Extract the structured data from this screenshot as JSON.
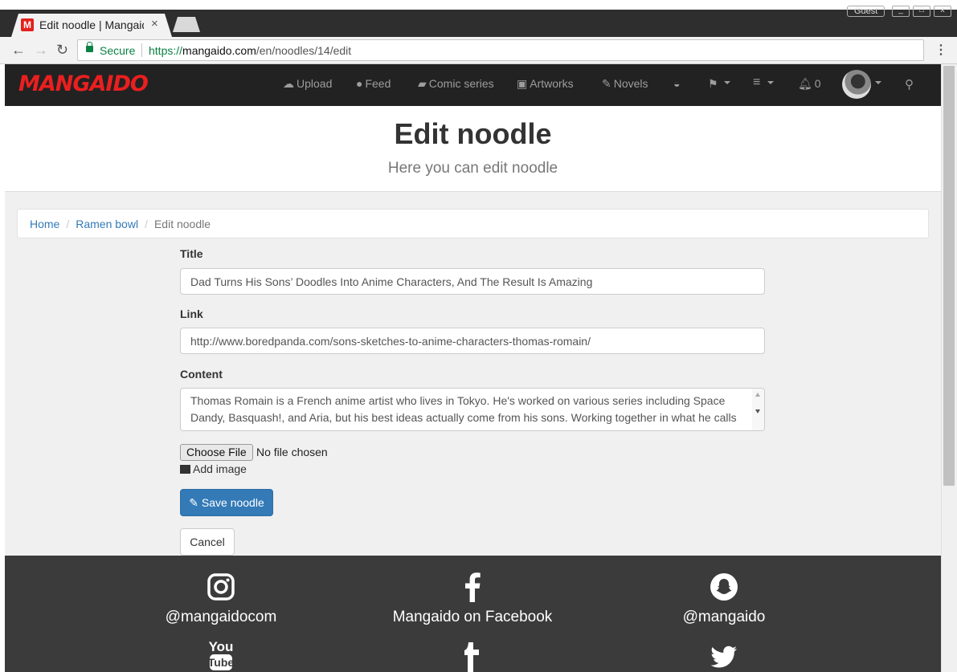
{
  "browser": {
    "tab_title": "Edit noodle | Mangaido",
    "tab_favicon": "M",
    "profile": "Guest",
    "secure_label": "Secure",
    "url_scheme": "https://",
    "url_host": "mangaido.com",
    "url_path": "/en/noodles/14/edit"
  },
  "navbar": {
    "logo": "MANGAIDO",
    "items": [
      {
        "icon": "cloud-upload-icon",
        "label": "Upload"
      },
      {
        "icon": "comments-icon",
        "label": "Feed"
      },
      {
        "icon": "book-icon",
        "label": "Comic series"
      },
      {
        "icon": "picture-icon",
        "label": "Artworks"
      },
      {
        "icon": "edit-icon",
        "label": "Novels"
      }
    ],
    "notifications_count": "0"
  },
  "header": {
    "title": "Edit noodle",
    "subtitle": "Here you can edit noodle"
  },
  "breadcrumb": {
    "home": "Home",
    "parent": "Ramen bowl",
    "current": "Edit noodle",
    "separator": "/"
  },
  "form": {
    "title_label": "Title",
    "title_value": "Dad Turns His Sons’ Doodles Into Anime Characters, And The Result Is Amazing",
    "link_label": "Link",
    "link_value": "http://www.boredpanda.com/sons-sketches-to-anime-characters-thomas-romain/",
    "content_label": "Content",
    "content_value": "Thomas Romain is a French anime artist who lives in Tokyo. He's worked on various series including Space Dandy, Basquash!, and Aria, but his best ideas actually come from his sons. Working together in what he calls the Father And Sons Design Workshop, Thomas and his kids create original",
    "file_button": "Choose File",
    "file_status": "No file chosen",
    "add_image": "Add image",
    "save_button": "Save noodle",
    "cancel_button": "Cancel"
  },
  "footer": {
    "instagram": "@mangaidocom",
    "facebook": "Mangaido on Facebook",
    "snapchat": "@mangaido"
  },
  "colors": {
    "brand": "#ea1f1f",
    "navbar_bg": "#222222",
    "primary": "#337ab7",
    "footer_bg": "#3b3b3b",
    "link": "#337ab7"
  }
}
